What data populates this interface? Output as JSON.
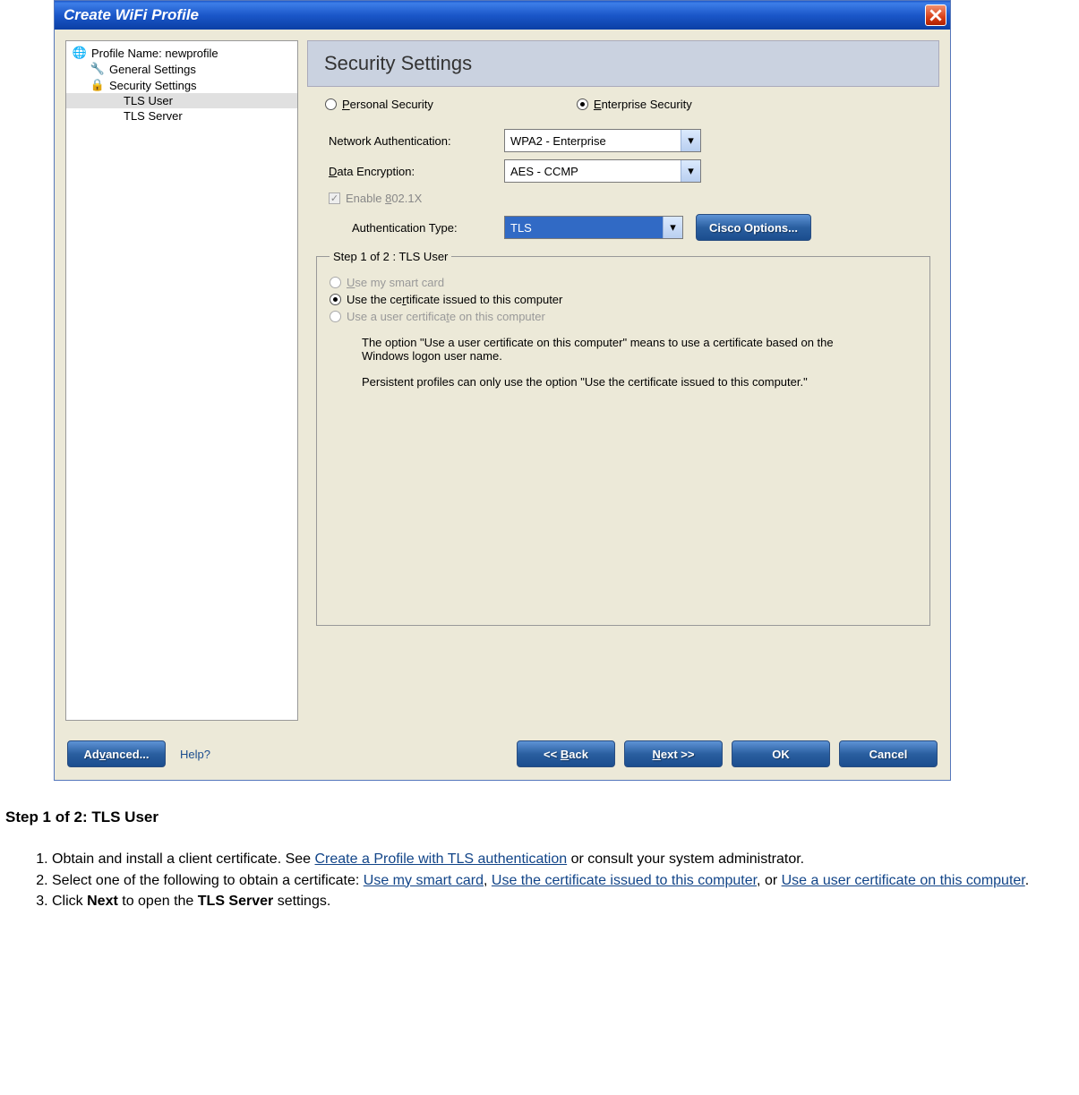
{
  "dialog": {
    "title": "Create WiFi Profile",
    "heading": "Security Settings"
  },
  "tree": {
    "items": [
      {
        "label": "Profile Name: newprofile",
        "icon": "globe"
      },
      {
        "label": "General Settings",
        "icon": "tool"
      },
      {
        "label": "Security Settings",
        "icon": "lock"
      },
      {
        "label": "TLS User",
        "icon": "",
        "selected": true
      },
      {
        "label": "TLS Server",
        "icon": ""
      }
    ]
  },
  "security": {
    "personal_label": "Personal Security",
    "enterprise_label": "Enterprise Security",
    "net_auth_label": "Network Authentication:",
    "net_auth_value": "WPA2 - Enterprise",
    "data_enc_label": "Data Encryption:",
    "data_enc_value": "AES - CCMP",
    "enable_8021x": "Enable 802.1X",
    "auth_type_label": "Authentication Type:",
    "auth_type_value": "TLS",
    "cisco_btn": "Cisco Options..."
  },
  "step": {
    "legend": "Step 1 of 2 : TLS User",
    "opt_smart": "Use my smart card",
    "opt_computer": "Use the certificate issued to this computer",
    "opt_user": "Use a user certificate on this computer",
    "info1": "The option \"Use a user certificate on this computer\" means to use a certificate based on the Windows logon user name.",
    "info2": "Persistent profiles can only use the option \"Use the certificate issued to this computer.\""
  },
  "buttons": {
    "advanced": "Advanced...",
    "help": "Help?",
    "back": "<< Back",
    "next": "Next >>",
    "ok": "OK",
    "cancel": "Cancel"
  },
  "doc": {
    "heading": "Step 1 of 2: TLS User",
    "li1a": "Obtain and install a client certificate. See ",
    "li1_link": "Create a Profile with TLS authentication",
    "li1b": " or consult your system administrator.",
    "li2a": "Select one of the following to obtain a certificate: ",
    "li2_link1": "Use my smart card",
    "li2_sep1": ", ",
    "li2_link2": "Use the certificate issued to this computer",
    "li2_sep2": ", or ",
    "li2_link3": "Use a user certificate on this computer",
    "li2b": ".",
    "li3a": "Click ",
    "li3_bold1": "Next",
    "li3b": " to open the ",
    "li3_bold2": "TLS Server",
    "li3c": " settings."
  }
}
